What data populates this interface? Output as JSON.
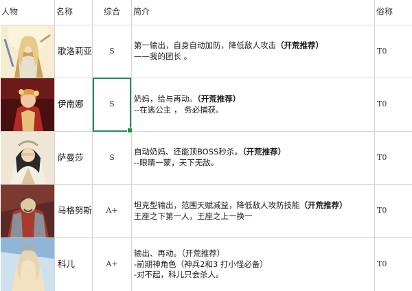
{
  "table": {
    "headers": {
      "character": "人物",
      "name": "名称",
      "overall": "综合",
      "intro": "简介",
      "alias": "俗称"
    },
    "rows": [
      {
        "name": "歌洛莉亚",
        "grade": "S",
        "intro_line1": "第一输出，自身自动加防，降低敌人攻击",
        "intro_tag": "（开荒推荐）",
        "intro_line2": "——我的团长 。",
        "intro_line3": "",
        "tier": "T0",
        "portrait_palette": [
          "#e9d7a8",
          "#c9a25a",
          "#f4e6c4",
          "#7a8aa5"
        ]
      },
      {
        "name": "伊南娜",
        "grade": "S",
        "intro_line1": "奶妈，给与再动。",
        "intro_tag": "（开荒推荐）",
        "intro_line2": "--在逃公主 ， 务必捕获。",
        "intro_line3": "",
        "tier": "T0",
        "portrait_palette": [
          "#8e1d1d",
          "#e6b98a",
          "#c23b2a",
          "#f2d27a"
        ]
      },
      {
        "name": "萨曼莎",
        "grade": "S",
        "intro_line1": "自动奶妈、还能顶BOSS秒杀。",
        "intro_tag": "（开荒推荐）",
        "intro_line2": "--眼睛一蒙，天下无敌。",
        "intro_line3": "",
        "tier": "T0",
        "portrait_palette": [
          "#efe6d6",
          "#2a2a2a",
          "#d9c7a0",
          "#b8a27a"
        ]
      },
      {
        "name": "马格努斯",
        "grade": "A+",
        "intro_line1": "坦克型输出，范围天赋减益，降低敌人攻防技能",
        "intro_tag": "（开荒推荐）",
        "intro_line2": "王座之下第一人，王座之上一换一",
        "intro_line3": "",
        "tier": "T0",
        "portrait_palette": [
          "#a83a2e",
          "#8a8f99",
          "#e0c9a6",
          "#3a3f4a"
        ]
      },
      {
        "name": "科儿",
        "grade": "A+",
        "intro_line1": "输出、再动。（开荒推荐）",
        "intro_tag": "",
        "intro_line2": "-前期神角色（神兵2和3 打小怪必备）",
        "intro_line3": "-对不起，科儿只会杀人。",
        "tier": "T0",
        "portrait_palette": [
          "#8fb6d6",
          "#e8d4b0",
          "#f2e2c2",
          "#c9a77a"
        ]
      }
    ]
  }
}
